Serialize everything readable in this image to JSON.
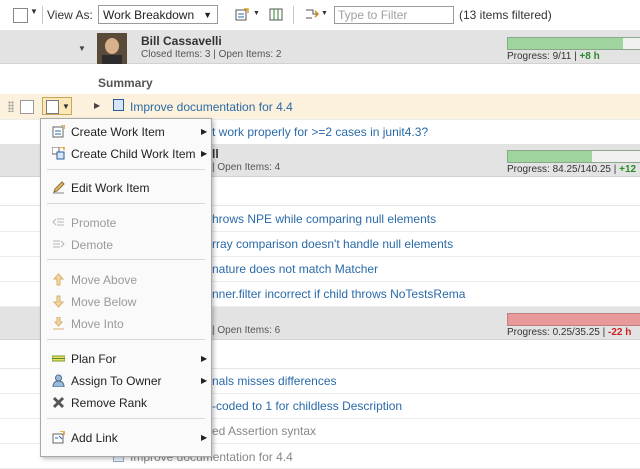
{
  "toolbar": {
    "view_as_label": "View As:",
    "view_select_value": "Work Breakdown",
    "filter_placeholder": "Type to Filter",
    "filter_count": "(13 items filtered)"
  },
  "summary_label": "Summary",
  "owners": [
    {
      "name": "Bill Cassavelli",
      "items_text": "Closed Items: 3 | Open Items: 2",
      "progress_prefix": "Progress: 9/11 | ",
      "progress_delta": "+8 h",
      "progress_fraction": 0.82,
      "progress_color": "#9fd49f"
    },
    {
      "name": "ll",
      "items_text": "| Open Items: 4",
      "progress_prefix": "Progress: 84.25/140.25 | ",
      "progress_delta": "+12",
      "progress_fraction": 0.6,
      "progress_color": "#9fd49f"
    },
    {
      "name": "",
      "items_text": "| Open Items: 6",
      "progress_prefix": "Progress: 0.25/35.25 | ",
      "progress_delta": "-22 h",
      "progress_fraction": 1.0,
      "progress_color": "#e89a9a"
    }
  ],
  "items": [
    "Improve documentation for 4.4",
    "t work properly for >=2 cases in junit4.3?",
    "hrows NPE while comparing null elements",
    "rray comparison doesn't handle null elements",
    "nature does not match Matcher",
    "nner.filter incorrect if child throws NoTestsRema",
    "nals misses differences",
    "-coded to 1 for childless Description",
    "ed Assertion syntax",
    "Improve documentation for 4.4"
  ],
  "menu": [
    {
      "label": "Create Work Item",
      "icon": "create-work-item-icon",
      "submenu": true,
      "disabled": false
    },
    {
      "label": "Create Child Work Item",
      "icon": "create-child-work-item-icon",
      "submenu": true,
      "disabled": false
    },
    {
      "label": "Edit Work Item",
      "icon": "edit-pencil-icon",
      "submenu": false,
      "disabled": false
    },
    {
      "label": "Promote",
      "icon": "promote-icon",
      "submenu": false,
      "disabled": true
    },
    {
      "label": "Demote",
      "icon": "demote-icon",
      "submenu": false,
      "disabled": true
    },
    {
      "label": "Move Above",
      "icon": "move-above-icon",
      "submenu": false,
      "disabled": true
    },
    {
      "label": "Move Below",
      "icon": "move-below-icon",
      "submenu": false,
      "disabled": true
    },
    {
      "label": "Move Into",
      "icon": "move-into-icon",
      "submenu": false,
      "disabled": true
    },
    {
      "label": "Plan For",
      "icon": "plan-for-icon",
      "submenu": true,
      "disabled": false
    },
    {
      "label": "Assign To Owner",
      "icon": "user-icon",
      "submenu": true,
      "disabled": false
    },
    {
      "label": "Remove Rank",
      "icon": "remove-x-icon",
      "submenu": false,
      "disabled": false
    },
    {
      "label": "Add Link",
      "icon": "add-link-icon",
      "submenu": true,
      "disabled": false
    }
  ]
}
